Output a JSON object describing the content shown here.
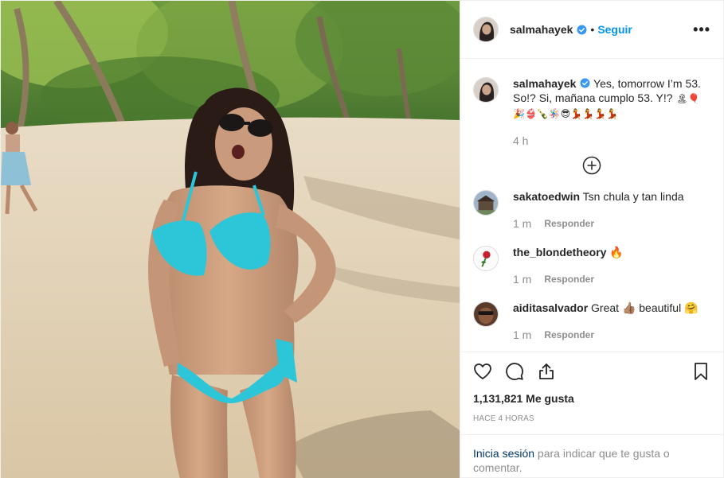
{
  "post": {
    "username": "salmahayek",
    "separator": "•",
    "follow_label": "Seguir",
    "more_label": "•••"
  },
  "caption": {
    "username": "salmahayek",
    "text": "Yes, tomorrow I’m 53. So!? Si, mañana cumplo 53. Y!?",
    "emoji_line1": "🏝🎈",
    "emoji_line2": "🎉👙🍾🪅😎💃💃💃💃",
    "time": "4 h"
  },
  "comments": [
    {
      "username": "sakatoedwin",
      "text": "Tsn chula y tan linda",
      "time": "1 m",
      "reply": "Responder"
    },
    {
      "username": "the_blondetheory",
      "text": "🔥",
      "time": "1 m",
      "reply": "Responder"
    },
    {
      "username": "aiditasalvador",
      "text": "Great 👍🏽 beautiful 🤗",
      "time": "1 m",
      "reply": "Responder"
    }
  ],
  "stats": {
    "likes": "1,131,821 Me gusta",
    "ago": "HACE 4 HORAS"
  },
  "login": {
    "link": "Inicia sesión",
    "rest": " para indicar que te gusta o comentar."
  },
  "colors": {
    "accent": "#0095f6",
    "verified": "#3897f0",
    "muted": "#8e8e8e",
    "bikini": "#2cc6d8"
  }
}
